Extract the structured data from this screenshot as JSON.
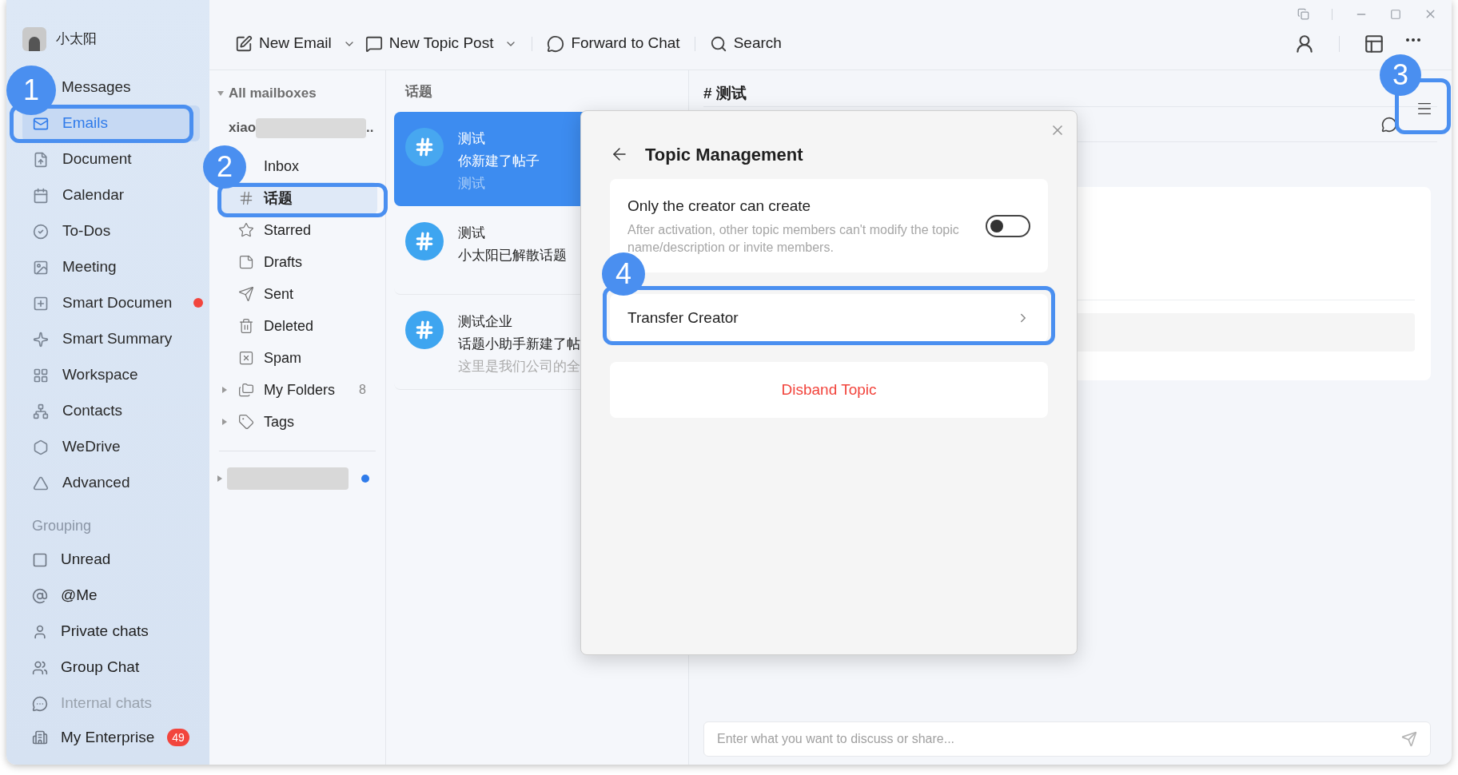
{
  "user": {
    "name": "小太阳"
  },
  "nav": [
    {
      "label": "Messages",
      "selected": false,
      "dot": false
    },
    {
      "label": "Emails",
      "selected": true,
      "dot": false
    },
    {
      "label": "Document",
      "selected": false,
      "dot": false
    },
    {
      "label": "Calendar",
      "selected": false,
      "dot": false
    },
    {
      "label": "To-Dos",
      "selected": false,
      "dot": false
    },
    {
      "label": "Meeting",
      "selected": false,
      "dot": false
    },
    {
      "label": "Smart Documen",
      "selected": false,
      "dot": true
    },
    {
      "label": "Smart Summary",
      "selected": false,
      "dot": false
    },
    {
      "label": "Workspace",
      "selected": false,
      "dot": false
    },
    {
      "label": "Contacts",
      "selected": false,
      "dot": false
    },
    {
      "label": "WeDrive",
      "selected": false,
      "dot": false
    },
    {
      "label": "Advanced",
      "selected": false,
      "dot": false
    }
  ],
  "grouping": {
    "title": "Grouping",
    "items": [
      "Unread",
      "@Me",
      "Private chats",
      "Group Chat",
      "Internal chats"
    ]
  },
  "enterprise": {
    "label": "My Enterprise",
    "badge": "49"
  },
  "toolbar": [
    {
      "label": "New Email",
      "dropdown": true
    },
    {
      "label": "New Topic Post",
      "dropdown": true
    },
    {
      "label": "Forward to Chat",
      "dropdown": false
    },
    {
      "label": "Search",
      "dropdown": false
    }
  ],
  "mailboxes": {
    "title": "All mailboxes",
    "expanded": true,
    "account": {
      "name": "xiao",
      "trailing": ".."
    },
    "folders": [
      {
        "label": "Inbox",
        "selected": false,
        "kind": "folder"
      },
      {
        "label": "话题",
        "selected": true,
        "kind": "folder"
      },
      {
        "label": "Starred",
        "selected": false,
        "kind": "folder"
      },
      {
        "label": "Drafts",
        "selected": false,
        "kind": "folder"
      },
      {
        "label": "Sent",
        "selected": false,
        "kind": "folder"
      },
      {
        "label": "Deleted",
        "selected": false,
        "kind": "folder"
      },
      {
        "label": "Spam",
        "selected": false,
        "kind": "folder"
      },
      {
        "label": "My Folders",
        "selected": false,
        "kind": "group",
        "expanded": false,
        "count": "8"
      },
      {
        "label": "Tags",
        "selected": false,
        "kind": "group",
        "expanded": false
      }
    ],
    "other_account": {
      "unread": true
    }
  },
  "topics": {
    "title": "话题",
    "items": [
      {
        "title": "测试",
        "preview": "你新建了帖子",
        "detail": "测试",
        "selected": true
      },
      {
        "title": "测试",
        "preview": "小太阳已解散话题",
        "selected": false
      },
      {
        "title": "测试企业",
        "preview": "话题小助手新建了帖",
        "detail": "这里是我们公司的全",
        "selected": false
      }
    ]
  },
  "conversation": {
    "title": "# 测试",
    "input": {
      "placeholder": "Enter what you want to discuss or share..."
    }
  },
  "dialog": {
    "title": "Topic Management",
    "setting": {
      "label": "Only the creator can create",
      "description": "After activation, other topic members can't modify the topic name/description or invite members.",
      "on": false
    },
    "actions": [
      {
        "label": "Transfer Creator",
        "kind": "link"
      },
      {
        "label": "Disband Topic",
        "kind": "danger"
      }
    ]
  },
  "callouts": [
    "1",
    "2",
    "3",
    "4"
  ]
}
